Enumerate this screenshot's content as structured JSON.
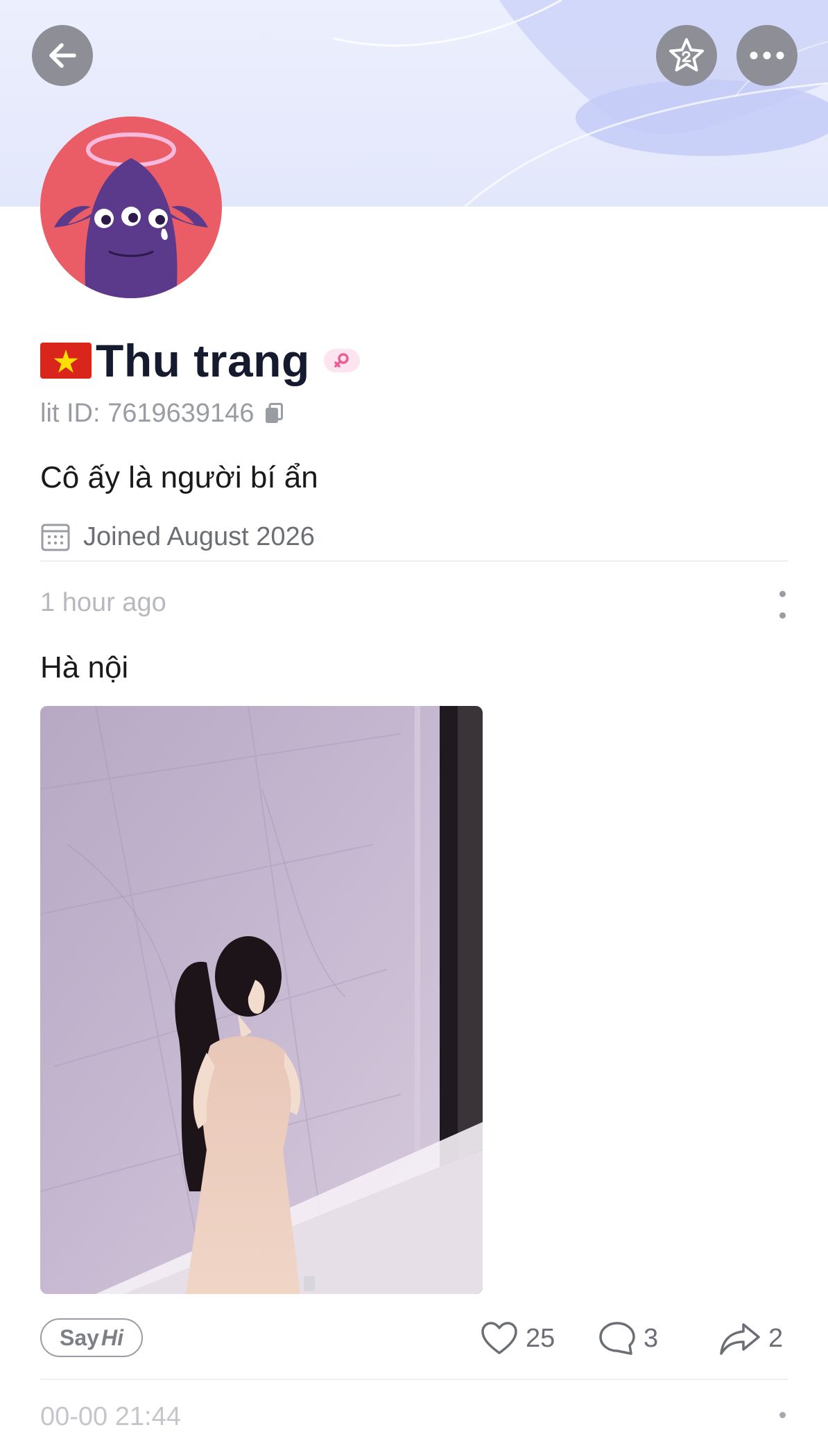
{
  "profile": {
    "name": "Thu trang",
    "id_text": "lit ID: 7619639146",
    "bio": "Cô ấy là người bí ẩn",
    "joined": "Joined August 2026",
    "country_flag": "vietnam-flag",
    "gender": "female"
  },
  "header": {
    "back_icon": "arrow-left-icon",
    "favorite_icon": "star-icon",
    "more_icon": "more-horizontal-icon"
  },
  "post": {
    "time": "1 hour ago",
    "text": "Hà nội",
    "image_icon": "photo",
    "sayhi": {
      "say": "Say",
      "hi": "Hi"
    },
    "likes": "25",
    "comments": "3",
    "shares": "2"
  },
  "next_post": {
    "time": "00-00 21:44"
  },
  "colors": {
    "header_bg": "#e3e7fb",
    "avatar_bg": "#ea5d66",
    "monster": "#5b3a8c",
    "icon_button": "#8e8f96"
  }
}
